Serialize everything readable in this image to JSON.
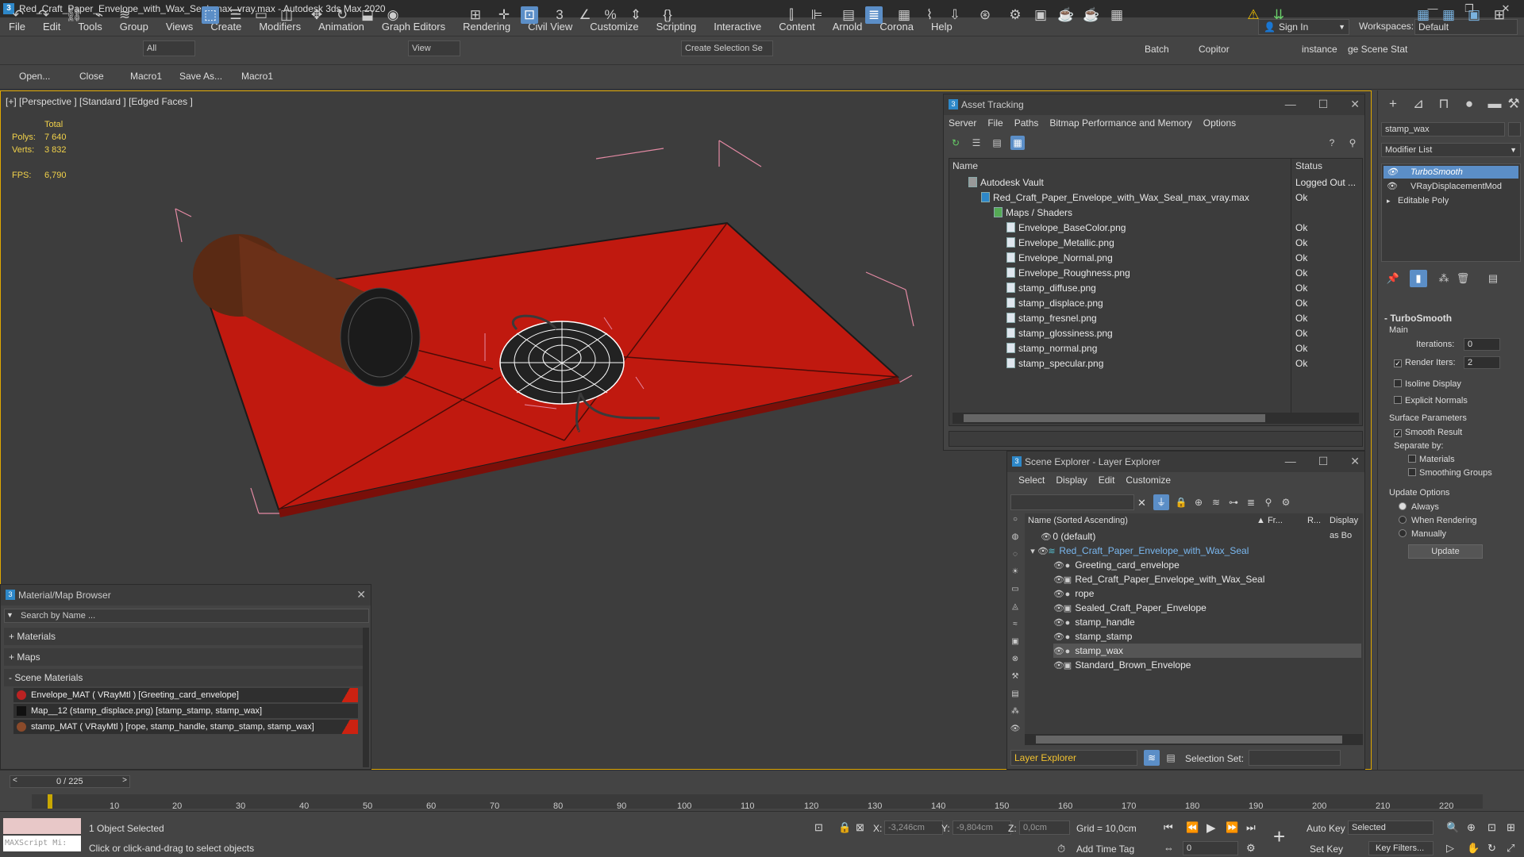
{
  "window": {
    "title": "Red_Craft_Paper_Envelope_with_Wax_Seal_max_vray.max - Autodesk 3ds Max 2020",
    "minimize": "—",
    "maximize": "❐",
    "close": "✕"
  },
  "menu": [
    "File",
    "Edit",
    "Tools",
    "Group",
    "Views",
    "Create",
    "Modifiers",
    "Animation",
    "Graph Editors",
    "Rendering",
    "Civil View",
    "Customize",
    "Scripting",
    "Interactive",
    "Content",
    "Arnold",
    "Corona",
    "Help"
  ],
  "signin": {
    "label": "Sign In"
  },
  "workspaces": {
    "label": "Workspaces:",
    "value": "Default"
  },
  "toolbar": {
    "filter_value": "All",
    "view_value": "View",
    "create_selection_value": "Create Selection Se",
    "batch": "Batch",
    "copitor": "Copitor",
    "instance": "instance",
    "scene_stat": "ge Scene Stat"
  },
  "toolbar2": [
    "Open...",
    "Close",
    "Macro1",
    "Save As...",
    "Macro1"
  ],
  "viewport": {
    "label": "[+] [Perspective ] [Standard ] [Edged Faces ]",
    "stats": {
      "total_label": "Total",
      "polys_label": "Polys:",
      "polys": "7 640",
      "verts_label": "Verts:",
      "verts": "3 832",
      "fps_label": "FPS:",
      "fps": "6,790"
    }
  },
  "asset_tracking": {
    "title": "Asset Tracking",
    "menu": [
      "Server",
      "File",
      "Paths",
      "Bitmap Performance and Memory",
      "Options"
    ],
    "col_name": "Name",
    "col_status": "Status",
    "rows": [
      {
        "name": "Autodesk Vault",
        "status": "Logged Out ..."
      },
      {
        "name": "Red_Craft_Paper_Envelope_with_Wax_Seal_max_vray.max",
        "status": "Ok"
      },
      {
        "name": "Maps / Shaders",
        "status": ""
      },
      {
        "name": "Envelope_BaseColor.png",
        "status": "Ok"
      },
      {
        "name": "Envelope_Metallic.png",
        "status": "Ok"
      },
      {
        "name": "Envelope_Normal.png",
        "status": "Ok"
      },
      {
        "name": "Envelope_Roughness.png",
        "status": "Ok"
      },
      {
        "name": "stamp_diffuse.png",
        "status": "Ok"
      },
      {
        "name": "stamp_displace.png",
        "status": "Ok"
      },
      {
        "name": "stamp_fresnel.png",
        "status": "Ok"
      },
      {
        "name": "stamp_glossiness.png",
        "status": "Ok"
      },
      {
        "name": "stamp_normal.png",
        "status": "Ok"
      },
      {
        "name": "stamp_specular.png",
        "status": "Ok"
      }
    ]
  },
  "scene_explorer": {
    "title": "Scene Explorer - Layer Explorer",
    "menu": [
      "Select",
      "Display",
      "Edit",
      "Customize"
    ],
    "col_name": "Name (Sorted Ascending)",
    "col_fr": "▲ Fr...",
    "col_r": "R...",
    "col_display": "Display as Bo",
    "rows": [
      {
        "name": "0 (default)"
      },
      {
        "name": "Red_Craft_Paper_Envelope_with_Wax_Seal"
      },
      {
        "name": "Greeting_card_envelope"
      },
      {
        "name": "Red_Craft_Paper_Envelope_with_Wax_Seal"
      },
      {
        "name": "rope"
      },
      {
        "name": "Sealed_Craft_Paper_Envelope"
      },
      {
        "name": "stamp_handle"
      },
      {
        "name": "stamp_stamp"
      },
      {
        "name": "stamp_wax"
      },
      {
        "name": "Standard_Brown_Envelope"
      }
    ],
    "footer_dropdown": "Layer Explorer",
    "selection_set_label": "Selection Set:"
  },
  "material_browser": {
    "title": "Material/Map Browser",
    "search_placeholder": "Search by Name ...",
    "materials": "+ Materials",
    "maps": "+ Maps",
    "scene_materials": "- Scene Materials",
    "items": [
      {
        "label": "Envelope_MAT ( VRayMtl ) [Greeting_card_envelope]"
      },
      {
        "label": "Map__12 (stamp_displace.png) [stamp_stamp, stamp_wax]"
      },
      {
        "label": "stamp_MAT ( VRayMtl ) [rope, stamp_handle, stamp_stamp, stamp_wax]"
      }
    ]
  },
  "command_panel": {
    "object_name": "stamp_wax",
    "modifier_list": "Modifier List",
    "stack": [
      "TurboSmooth",
      "VRayDisplacementMod",
      "Editable Poly"
    ],
    "turbosmooth_title": "TurboSmooth",
    "main": "Main",
    "iterations_label": "Iterations:",
    "iterations": "0",
    "render_iters_label": "Render Iters:",
    "render_iters": "2",
    "isoline": "Isoline Display",
    "explicit": "Explicit Normals",
    "surface_params": "Surface Parameters",
    "smooth_result": "Smooth Result",
    "separate_by": "Separate by:",
    "sep_materials": "Materials",
    "sep_smoothing": "Smoothing Groups",
    "update_options": "Update Options",
    "always": "Always",
    "when_rendering": "When Rendering",
    "manually": "Manually",
    "update_btn": "Update"
  },
  "timeline": {
    "frame_display": "0 / 225",
    "ticks": [
      "10",
      "20",
      "30",
      "40",
      "50",
      "60",
      "70",
      "80",
      "90",
      "100",
      "110",
      "120",
      "130",
      "140",
      "150",
      "160",
      "170",
      "180",
      "190",
      "200",
      "210",
      "220"
    ]
  },
  "status": {
    "maxscript": "MAXScript Mi:",
    "selected": "1 Object Selected",
    "prompt": "Click or click-and-drag to select objects",
    "x_label": "X:",
    "x": "-3,246cm",
    "y_label": "Y:",
    "y": "-9,804cm",
    "z_label": "Z:",
    "z": "0,0cm",
    "grid": "Grid = 10,0cm",
    "add_time_tag": "Add Time Tag",
    "auto_key": "Auto Key",
    "set_key": "Set Key",
    "selected_dd": "Selected",
    "key_filters": "Key Filters...",
    "frame": "0"
  }
}
